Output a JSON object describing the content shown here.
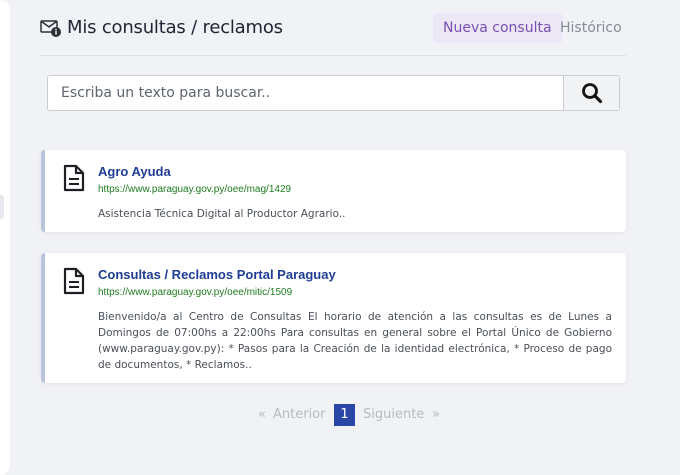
{
  "header": {
    "title": "Mis consultas / reclamos",
    "title_icon": "mail-info-icon",
    "tabs": [
      {
        "label": "Nueva consulta",
        "active": true
      },
      {
        "label": "Histórico",
        "active": false
      }
    ]
  },
  "search": {
    "placeholder": "Escriba un texto para buscar..",
    "value": "",
    "button_icon": "search-icon"
  },
  "results": [
    {
      "icon": "document-icon",
      "title": "Agro Ayuda",
      "url": "https://www.paraguay.gov.py/oee/mag/1429",
      "description": "Asistencia Técnica Digital al Productor Agrario.."
    },
    {
      "icon": "document-icon",
      "title": "Consultas / Reclamos Portal Paraguay",
      "url": "https://www.paraguay.gov.py/oee/mitic/1509",
      "description": "Bienvenido/a al Centro de Consultas El horario de atención a las consultas es de Lunes a Domingos de 07:00hs a 22:00hs Para consultas en general sobre el Portal Único de Gobierno (www.paraguay.gov.py): * Pasos para la Creación de la identidad electrónica, * Proceso de pago de documentos, * Reclamos.."
    }
  ],
  "pagination": {
    "first_symbol": "«",
    "prev_label": "Anterior",
    "current_page": "1",
    "next_label": "Siguiente",
    "last_symbol": "»"
  },
  "colors": {
    "accent": "#7b4fb6",
    "title_link": "#1f3c96",
    "url_green": "#1e7c1e",
    "pagination_active": "#2a47a7"
  }
}
